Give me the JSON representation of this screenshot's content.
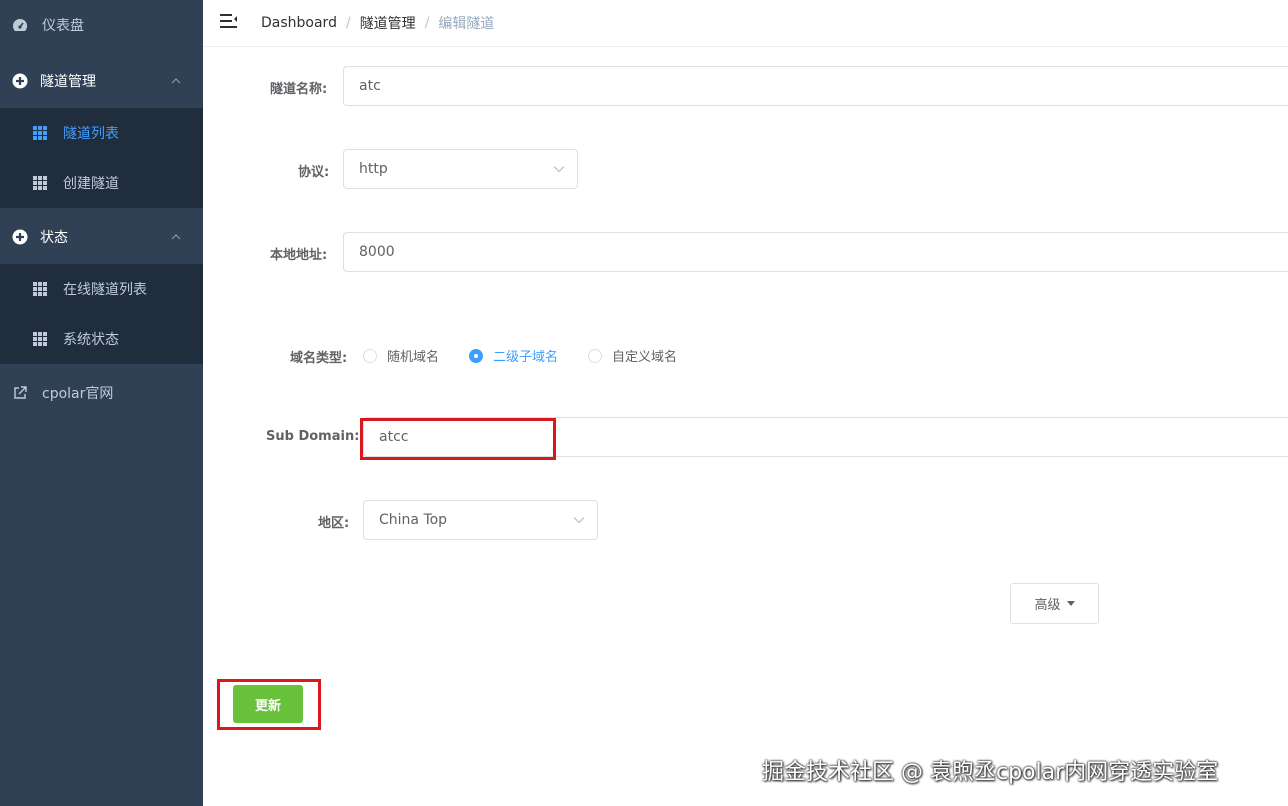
{
  "sidebar": {
    "dashboard": {
      "label": "仪表盘",
      "icon": "dashboard-icon"
    },
    "tunnel_mgmt": {
      "label": "隧道管理",
      "icon": "circle-plus-icon"
    },
    "tunnel_list": {
      "label": "隧道列表",
      "icon": "table-icon"
    },
    "create_tunnel": {
      "label": "创建隧道",
      "icon": "table-icon"
    },
    "status": {
      "label": "状态",
      "icon": "circle-plus-icon"
    },
    "online_tunnels": {
      "label": "在线隧道列表",
      "icon": "table-icon"
    },
    "system_status": {
      "label": "系统状态",
      "icon": "table-icon"
    },
    "cpolar_site": {
      "label": "cpolar官网",
      "icon": "external-link-icon"
    }
  },
  "breadcrumb": [
    "Dashboard",
    "隧道管理",
    "编辑隧道"
  ],
  "form": {
    "name_label": "隧道名称:",
    "name_value": "atc",
    "protocol_label": "协议:",
    "protocol_value": "http",
    "local_label": "本地地址:",
    "local_value": "8000",
    "domain_type_label": "域名类型:",
    "domain_types": [
      "随机域名",
      "二级子域名",
      "自定义域名"
    ],
    "domain_type_selected": "二级子域名",
    "subdomain_label": "Sub Domain:",
    "subdomain_value": "atcc",
    "region_label": "地区:",
    "region_value": "China Top",
    "advanced_label": "高级",
    "update_label": "更新"
  },
  "colors": {
    "sidebar_bg": "#304156",
    "submenu_bg": "#1f2d3d",
    "accent": "#409eff",
    "success": "#67c23a",
    "highlight": "#d9181c"
  },
  "watermark": "掘金技术社区 @ 袁煦丞cpolar内网穿透实验室"
}
